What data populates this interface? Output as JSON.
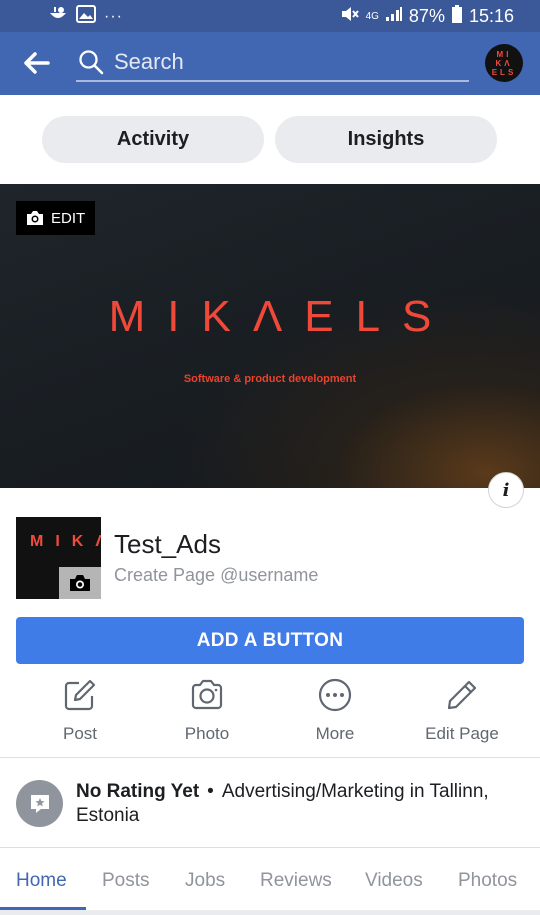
{
  "status_bar": {
    "more_dots": "···",
    "network": "4G",
    "battery": "87%",
    "time": "15:16"
  },
  "header": {
    "search_placeholder": "Search",
    "avatar_text": "MI KΛ ELS"
  },
  "pills": [
    "Activity",
    "Insights"
  ],
  "cover": {
    "edit_label": "EDIT",
    "logo_text": "MIKΛELS",
    "tagline": "Software & product development",
    "info_glyph": "i"
  },
  "page": {
    "profile_letters": "MIKΛEL",
    "name": "Test_Ads",
    "username_prompt": "Create Page @username"
  },
  "add_button_label": "ADD A BUTTON",
  "actions": [
    {
      "label": "Post",
      "icon": "edit-square-icon"
    },
    {
      "label": "Photo",
      "icon": "camera-icon"
    },
    {
      "label": "More",
      "icon": "more-dots-icon"
    },
    {
      "label": "Edit Page",
      "icon": "pencil-icon"
    }
  ],
  "rating": {
    "title": "No Rating Yet",
    "separator": "•",
    "category": "Advertising/Marketing in Tallinn, Estonia"
  },
  "tabs": [
    "Home",
    "Posts",
    "Jobs",
    "Reviews",
    "Videos",
    "Photos"
  ],
  "colors": {
    "brand_blue": "#4267b2",
    "button_blue": "#3f7ce8",
    "logo_red": "#f0493a"
  }
}
